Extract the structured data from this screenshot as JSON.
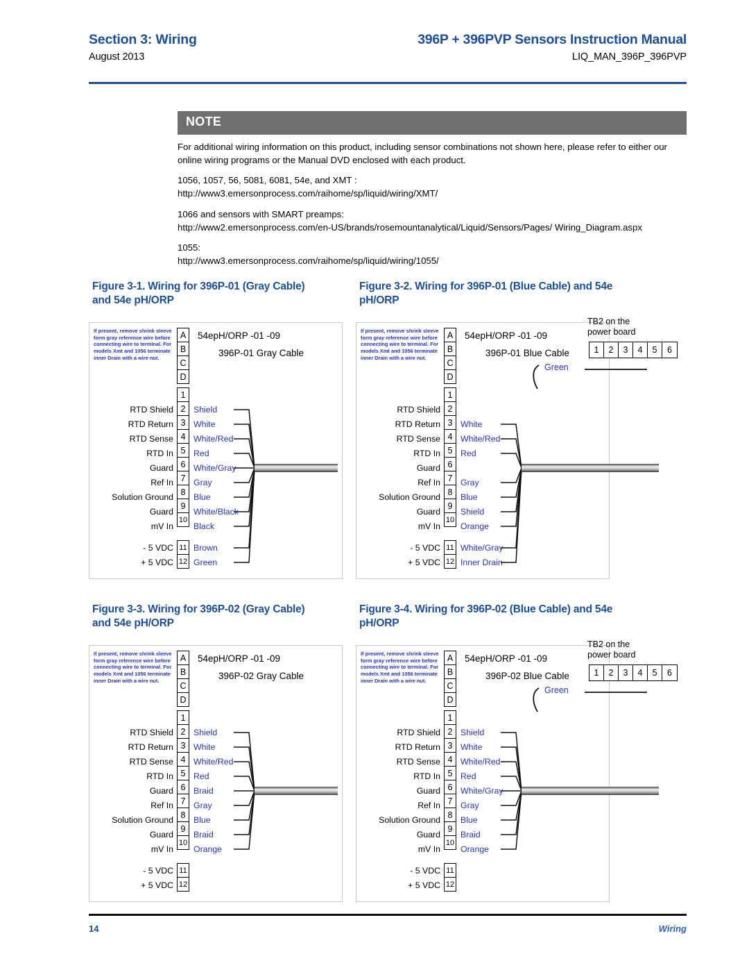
{
  "header": {
    "section_title": "Section 3: Wiring",
    "date": "August 2013",
    "manual_title": "396P + 396PVP Sensors Instruction Manual",
    "doc_code": "LIQ_MAN_396P_396PVP",
    "rule_color": "#1b4f9c"
  },
  "note": {
    "label": "NOTE",
    "bar_color": "#6e6e6e",
    "paragraph": "For additional wiring information on this product, including sensor combinations not shown here, please refer to either our online wiring programs or the Manual DVD enclosed with each product.",
    "entries": [
      {
        "models": "1056, 1057, 56, 5081, 6081, 54e, and XMT :",
        "url": "http://www3.emersonprocess.com/raihome/sp/liquid/wiring/XMT/"
      },
      {
        "models": "1066 and sensors with SMART preamps:",
        "url": "http://www2.emersonprocess.com/en-US/brands/rosemountanalytical/Liquid/Sensors/Pages/ Wiring_Diagram.aspx"
      },
      {
        "models": "1055:",
        "url": "http://www3.emersonprocess.com/raihome/sp/liquid/wiring/1055/"
      }
    ]
  },
  "common": {
    "blurb": "If present, remove shrink sleeve form gray reference wire before connecting wire to terminal.  For models Xmt and 1056 terminate inner Drain with a wire nut.",
    "letter_terminals": [
      "A",
      "B",
      "C",
      "D"
    ],
    "device_header": "54epH/ORP  -01  -09",
    "terminal_labels": [
      "",
      "RTD Shield",
      "RTD Return",
      "RTD Sense",
      "RTD In",
      "Guard",
      "Ref In",
      "Solution Ground",
      "Guard",
      "mV In"
    ],
    "power_labels": [
      "- 5 VDC",
      "+ 5 VDC"
    ],
    "terminal_numbers": [
      "1",
      "2",
      "3",
      "4",
      "5",
      "6",
      "7",
      "8",
      "9",
      "10"
    ],
    "power_numbers": [
      "11",
      "12"
    ],
    "tb2_caption_line1": "TB2 on the",
    "tb2_caption_line2": "power board",
    "tb2_cells": [
      "1",
      "2",
      "3",
      "4",
      "5",
      "6"
    ],
    "green_label": "Green",
    "wire_color": "#2433c6",
    "title_color": "#1b4f9c"
  },
  "figures": [
    {
      "id": "fig-3-1",
      "title_line1": "Figure 3-1. Wiring for 396P-01 (Gray Cable)",
      "title_line2": "and 54e pH/ORP",
      "cable_label": "396P-01 Gray Cable",
      "has_tb2": false,
      "wires": [
        "",
        "Shield",
        "White",
        "White/Red",
        "Red",
        "White/Gray",
        "Gray",
        "Blue",
        "White/Black",
        "Black"
      ],
      "power_wires": [
        "Brown",
        "Green"
      ]
    },
    {
      "id": "fig-3-2",
      "title_line1": "Figure 3-2. Wiring for 396P-01 (Blue Cable) and 54e",
      "title_line2": "pH/ORP",
      "cable_label": "396P-01 Blue Cable",
      "has_tb2": true,
      "wires": [
        "",
        "",
        "White",
        "White/Red",
        "Red",
        "",
        "Gray",
        "Blue",
        "Shield",
        "Orange"
      ],
      "power_wires": [
        "White/Gray",
        "Inner Drain"
      ]
    },
    {
      "id": "fig-3-3",
      "title_line1": "Figure 3-3. Wiring for 396P-02 (Gray Cable)",
      "title_line2": "and 54e pH/ORP",
      "cable_label": "396P-02 Gray Cable",
      "has_tb2": false,
      "wires": [
        "",
        "Shield",
        "White",
        "White/Red",
        "Red",
        "Braid",
        "Gray",
        "Blue",
        "Braid",
        "Orange"
      ],
      "power_wires": [
        "",
        ""
      ]
    },
    {
      "id": "fig-3-4",
      "title_line1": "Figure 3-4. Wiring for 396P-02 (Blue Cable) and 54e",
      "title_line2": "pH/ORP",
      "cable_label": "396P-02 Blue Cable",
      "has_tb2": true,
      "wires": [
        "",
        "Shield",
        "White",
        "White/Red",
        "Red",
        "White/Gray",
        "Gray",
        "Blue",
        "Braid",
        "Orange"
      ],
      "power_wires": [
        "",
        ""
      ]
    }
  ],
  "footer": {
    "page_number": "14",
    "section_name": "Wiring"
  }
}
